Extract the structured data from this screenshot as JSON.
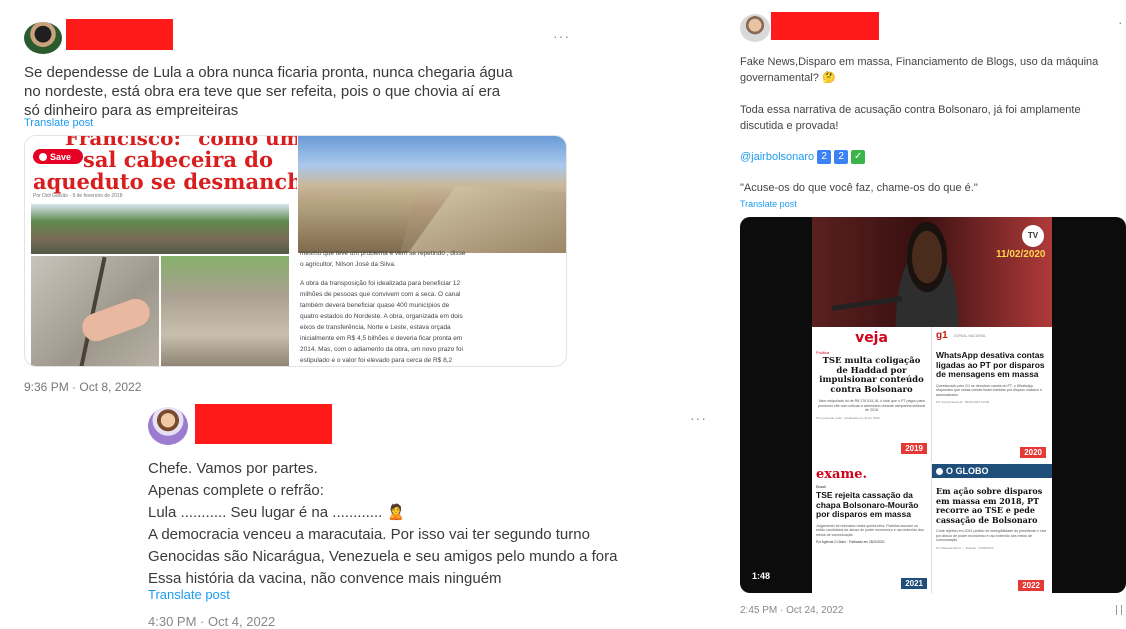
{
  "tweet1": {
    "more": "···",
    "text_lines": [
      "Se dependesse de Lula a obra nunca ficaria pronta, nunca chegaria água",
      "no nordeste, está obra era teve que ser refeita, pois o que chovia aí era",
      "só dinheiro para as empreiteiras"
    ],
    "translate": "Translate post",
    "timestamp": "9:36 PM · Oct 8, 2022",
    "article": {
      "top_partial": "Francisco: \"como um",
      "save_badge": "Save",
      "headline_l1": "sal cabeceira do",
      "headline_l2": "aqueduto se desmancha\"",
      "byline": "Por  Didi Galvão  ·  9 de fevereiro de 2018",
      "caption_cut": "mesmo que teve um problema e vem se repetindo , disse",
      "caption_l2": "o agricultor, Nilson José da Silva.",
      "body": [
        "A obra da transposição foi idealizada para beneficiar 12",
        "milhões de pessoas que convivem com a seca. O canal",
        "também deverá beneficiar quase 400 municípios de",
        "quatro estados do Nordeste. A obra, organizada em dois",
        "eixos de transferência, Norte e Leste, estava orçada",
        "inicialmente em R$ 4,5 bilhões e deveria ficar pronta em",
        "2014. Mas, com o adiamento da obra, um novo prazo foi",
        "estipulado e o valor foi elevado para cerca de R$ 8,2"
      ]
    }
  },
  "tweet2": {
    "more": "···",
    "lines": [
      "Chefe. Vamos por partes.",
      "Apenas complete o refrão:",
      "Lula ........... Seu lugar é na ............ 🙎",
      "A democracia venceu a maracutaia. Por isso vai ter segundo turno",
      "Genocidas são Nicarágua, Venezuela e seu amigos pelo mundo a fora",
      "Essa história da vacina, não convence mais ninguém"
    ],
    "translate": "Translate post",
    "timestamp": "4:30 PM · Oct 4, 2022"
  },
  "tweet3": {
    "more": "·",
    "line1": "Fake News,Disparo em massa, Financiamento de Blogs, uso da máquina",
    "line2": "governamental? 🤔",
    "line3": "Toda essa narrativa de acusação contra Bolsonaro, já foi amplamente",
    "line4": "discutida e provada!",
    "mention": "@jairbolsonaro",
    "emoji_badges": [
      "2",
      "2",
      "✓"
    ],
    "quote": "\"Acuse-os do que você faz, chame-os do que é.\"",
    "translate": "Translate post",
    "timestamp": "2:45 PM · Oct 24, 2022",
    "video": {
      "tv_logo": "TV",
      "date_overlay": "11/02/2020",
      "duration": "1:48",
      "panels": [
        {
          "brand": "veja",
          "section": "Política",
          "headline": "TSE multa coligação de Haddad por impulsionar conteúdo contra Bolsonaro",
          "summary": "Valor estipulado foi de R$ 176.515,18, o total que o PT pagou para promover site com críticas a adversário durante campanha eleitoral de 2018",
          "byline": "Por Leonardo Lellis · Atualizado em 11 fev 2020",
          "year": "2019"
        },
        {
          "brand": "g1",
          "section": "JORNAL NACIONAL",
          "headline": "WhatsApp desativa contas ligadas ao PT por disparos de mensagens em massa",
          "summary": "Questionado pelo G1 se derrubou canais do PT, o WhatsApp respondeu que várias contas foram banidas por disparo massivo e automatizado.",
          "byline": "Por Jornal Nacional · 09/07/2020 21h39",
          "year": "2020"
        },
        {
          "brand": "exame.",
          "section": "Brasil",
          "headline": "TSE rejeita cassação da chapa Bolsonaro-Mourão por disparos em massa",
          "summary": "Julgamento foi retomado nesta quinta-feira. Partidos acusam os então candidatos de abuso de poder econômico e uso indevido dos meios de comunicação",
          "byline": "Por Agência O Globo · Publicado em 28/10/2021",
          "year": "2021"
        },
        {
          "brand": "O GLOBO",
          "section": "",
          "headline": "Em ação sobre disparos em massa em 2018, PT recorre ao TSE e pede cassação de Bolsonaro",
          "summary": "Corte rejeitou em 2021 pedido de inelegibilidade do presidente e vice por abuso de poder econômico e uso indevido dos meios de comunicação",
          "byline": "Por Mariana Muniz — Brasília · 22/08/2022",
          "year": "2022"
        }
      ]
    }
  },
  "colors": {
    "redact": "#ff1a1a",
    "link": "#1d9bf0",
    "year_badge": "#e53935"
  }
}
